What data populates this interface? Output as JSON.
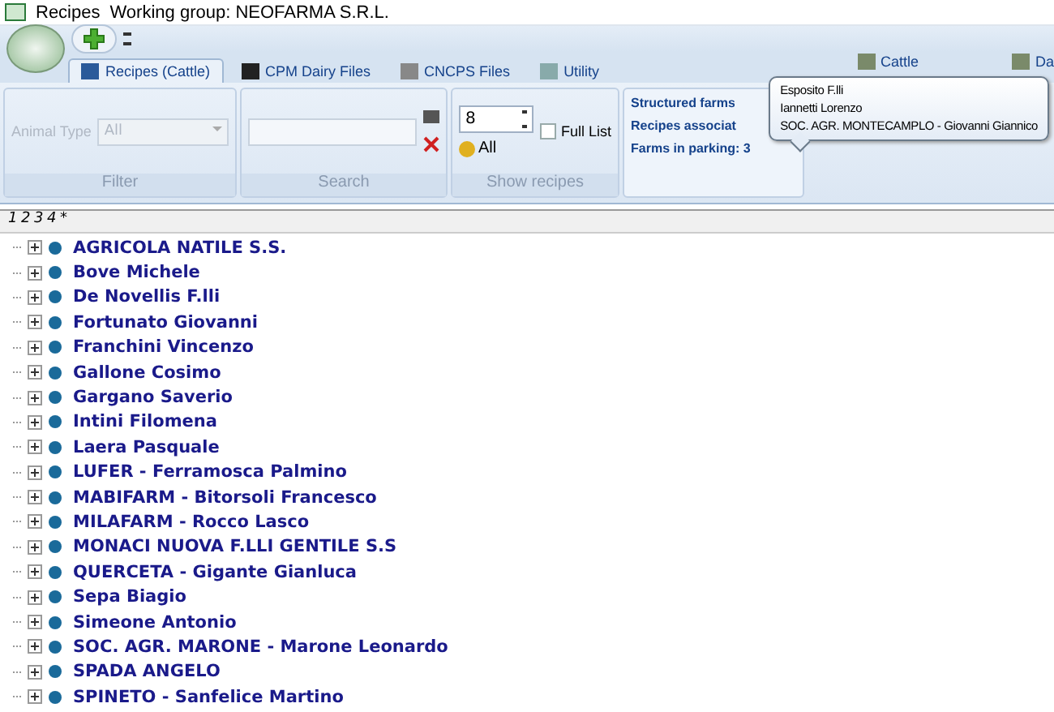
{
  "window": {
    "title": "Recipes",
    "working_group": "Working group:  NEOFARMA S.R.L."
  },
  "tabs": [
    {
      "label": "Recipes (Cattle)",
      "selected": true
    },
    {
      "label": "CPM Dairy Files",
      "selected": false
    },
    {
      "label": "CNCPS Files",
      "selected": false
    },
    {
      "label": "Utility",
      "selected": false
    }
  ],
  "right_tabs": [
    "Cattle",
    "Da"
  ],
  "filter": {
    "label": "Animal Type",
    "value": "All",
    "group": "Filter"
  },
  "search": {
    "group": "Search"
  },
  "show_recipes": {
    "count": "8",
    "all_label": "All",
    "full_list": {
      "label": "Full List",
      "checked": false
    },
    "group": "Show recipes"
  },
  "info": {
    "lines": [
      "Structured farms",
      "Recipes associat",
      "Farms in parking: 3"
    ]
  },
  "tooltip": {
    "lines": [
      "Esposito F.lli",
      "Iannetti Lorenzo",
      "SOC. AGR. MONTECAMPLO - Giovanni Giannico"
    ]
  },
  "levels": [
    "1",
    "2",
    "3",
    "4",
    "*"
  ],
  "tree": [
    {
      "label": "AGRICOLA NATILE S.S.",
      "expanded": false
    },
    {
      "label": "Bove Michele",
      "expanded": false
    },
    {
      "label": "De Novellis F.lli",
      "expanded": false
    },
    {
      "label": "Fortunato Giovanni",
      "expanded": false
    },
    {
      "label": "Franchini Vincenzo",
      "expanded": false
    },
    {
      "label": "Gallone Cosimo",
      "expanded": false
    },
    {
      "label": "Gargano Saverio",
      "expanded": false
    },
    {
      "label": "Intini Filomena",
      "expanded": false
    },
    {
      "label": "Laera Pasquale",
      "expanded": false
    },
    {
      "label": "LUFER - Ferramosca Palmino",
      "expanded": false
    },
    {
      "label": "MABIFARM - Bitorsoli Francesco",
      "expanded": false
    },
    {
      "label": "MILAFARM - Rocco Lasco",
      "expanded": false
    },
    {
      "label": "MONACI NUOVA F.LLI GENTILE S.S",
      "expanded": false
    },
    {
      "label": "QUERCETA - Gigante Gianluca",
      "expanded": false
    },
    {
      "label": "Sepa Biagio",
      "expanded": false
    },
    {
      "label": "Simeone Antonio",
      "expanded": false
    },
    {
      "label": "SOC. AGR. MARONE - Marone Leonardo",
      "expanded": false
    },
    {
      "label": "SPADA ANGELO",
      "expanded": false
    },
    {
      "label": "SPINETO - Sanfelice Martino",
      "expanded": false
    }
  ]
}
